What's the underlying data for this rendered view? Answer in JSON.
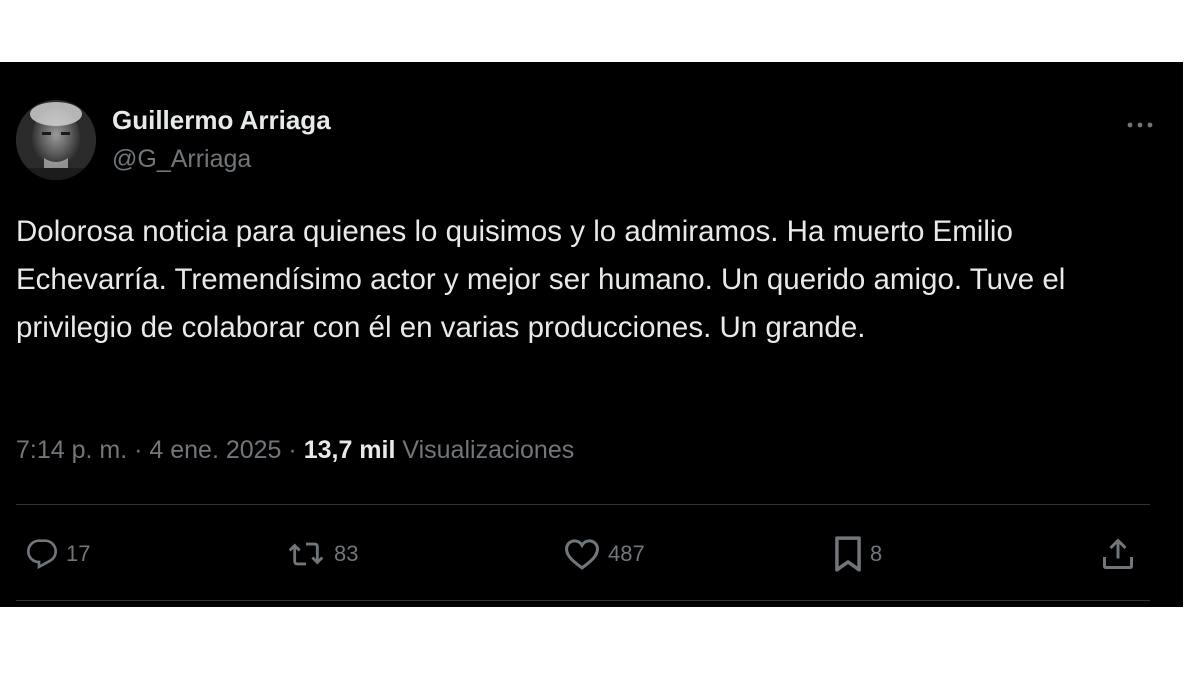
{
  "author": {
    "name": "Guillermo Arriaga",
    "handle": "@G_Arriaga"
  },
  "tweet": {
    "text": "Dolorosa noticia para quienes lo quisimos y lo admiramos. Ha muerto Emilio Echevarría. Tremendísimo actor y mejor ser humano. Un querido amigo. Tuve el privilegio de colaborar con él en varias producciones. Un grande.",
    "time": "7:14 p. m.",
    "separator1": " · ",
    "date": "4 ene. 2025",
    "separator2": " · ",
    "views_count": "13,7 mil",
    "views_label": "Visualizaciones"
  },
  "actions": {
    "replies": "17",
    "retweets": "83",
    "likes": "487",
    "bookmarks": "8"
  },
  "icons": {
    "more": "more-icon",
    "reply": "reply-icon",
    "retweet": "retweet-icon",
    "like": "heart-icon",
    "bookmark": "bookmark-icon",
    "share": "share-icon"
  },
  "colors": {
    "background": "#000000",
    "text": "#e7e9ea",
    "secondary": "#71767b",
    "divider": "#2f3336"
  }
}
